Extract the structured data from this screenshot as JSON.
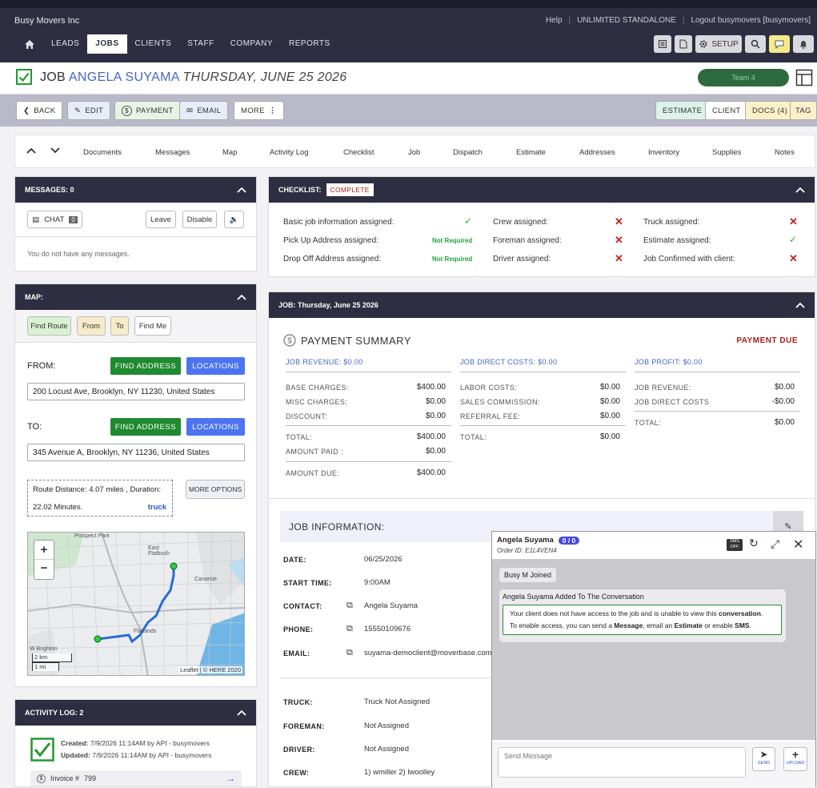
{
  "header": {
    "company": "Busy Movers Inc",
    "links": [
      "Help",
      "UNLIMITED STANDALONE",
      "Logout busymovers [busymovers]"
    ],
    "nav": [
      "LEADS",
      "JOBS",
      "CLIENTS",
      "STAFF",
      "COMPANY",
      "REPORTS"
    ],
    "active_nav": "JOBS",
    "setup_label": "SETUP"
  },
  "job": {
    "prefix": "JOB",
    "client_name": "ANGELA SUYAMA",
    "date": "THURSDAY, JUNE 25 2026",
    "team": "Team 4"
  },
  "actions": {
    "back": "BACK",
    "edit": "EDIT",
    "payment": "PAYMENT",
    "email": "EMAIL",
    "more": "MORE",
    "estimate": "ESTIMATE",
    "client": "CLIENT",
    "docs": "DOCS (4)",
    "tag": "TAG"
  },
  "tabs": [
    "Documents",
    "Messages",
    "Map",
    "Activity Log",
    "Checklist",
    "Job",
    "Dispatch",
    "Estimate",
    "Addresses",
    "Inventory",
    "Supplies",
    "Notes"
  ],
  "messages": {
    "title": "MESSAGES:",
    "count": "0",
    "chat_label": "CHAT",
    "chat_count": "0",
    "leave": "Leave",
    "disable": "Disable",
    "empty": "You do not have any messages."
  },
  "map": {
    "title": "MAP:",
    "find_route": "Find Route",
    "from_btn": "From",
    "to_btn": "To",
    "find_me": "Find Me",
    "from_label": "FROM:",
    "to_label": "TO:",
    "find_address": "FIND ADDRESS",
    "locations": "LOCATIONS",
    "from_value": "200 Locust Ave, Brooklyn, NY 11230, United States",
    "to_value": "345 Avenue A, Brooklyn, NY 11236, United States",
    "route_line1": "Route Distance: 4.07 miles , Duration:",
    "route_line2": "22.02 Minutes.",
    "route_mode": "truck",
    "more_options": "MORE OPTIONS",
    "zoom_in": "+",
    "zoom_out": "−",
    "scale_km": "2 km",
    "scale_mi": "1 mi",
    "attribution": "Leaflet | © HERE 2020",
    "labels": [
      "Prospect Park",
      "East Flatbush",
      "Canarsie",
      "Flatlands",
      "W Brighton"
    ]
  },
  "activity": {
    "title": "ACTIVITY LOG:",
    "count": "2",
    "created": "Created:",
    "created_val": "7/9/2026 11:14AM by API - busymovers",
    "updated": "Updated:",
    "updated_val": "7/9/2026 11:14AM by API - busymovers",
    "invoice_label": "Invoice #",
    "invoice_num": "799"
  },
  "checklist": {
    "title": "CHECKLIST:",
    "status": "COMPLETE",
    "items": [
      {
        "label": "Basic job information assigned:",
        "state": "ok"
      },
      {
        "label": "Pick Up Address assigned:",
        "state": "Not Required"
      },
      {
        "label": "Drop Off Address assigned:",
        "state": "Not Required"
      },
      {
        "label": "Crew assigned:",
        "state": "no"
      },
      {
        "label": "Foreman assigned:",
        "state": "no"
      },
      {
        "label": "Driver assigned:",
        "state": "no"
      },
      {
        "label": "Truck assigned:",
        "state": "no"
      },
      {
        "label": "Estimate assigned:",
        "state": "ok"
      },
      {
        "label": "Job Confirmed with client:",
        "state": "no"
      }
    ]
  },
  "jobpanel": {
    "title": "JOB:",
    "title_date": "Thursday, June 25 2026",
    "payment_title": "PAYMENT SUMMARY",
    "payment_status": "PAYMENT DUE",
    "revenue_head": "JOB REVENUE: $0.00",
    "costs_head": "JOB DIRECT COSTS: $0.00",
    "profit_head": "JOB PROFIT: $0.00",
    "revenue_rows": [
      [
        "BASE CHARGES:",
        "$400.00"
      ],
      [
        "MISC CHARGES:",
        "$0.00"
      ],
      [
        "DISCOUNT:",
        "$0.00"
      ]
    ],
    "revenue_total": [
      "TOTAL:",
      "$400.00"
    ],
    "amount_paid": [
      "AMOUNT PAID :",
      "$0.00"
    ],
    "amount_due": [
      "AMOUNT DUE:",
      "$400.00"
    ],
    "cost_rows": [
      [
        "LABOR COSTS:",
        "$0.00"
      ],
      [
        "SALES COMMISSION:",
        "$0.00"
      ],
      [
        "REFERRAL FEE:",
        "$0.00"
      ]
    ],
    "cost_total": [
      "TOTAL:",
      "$0.00"
    ],
    "profit_rows": [
      [
        "JOB REVENUE:",
        "$0.00"
      ],
      [
        "JOB DIRECT COSTS",
        "-$0.00"
      ]
    ],
    "profit_total": [
      "TOTAL:",
      "$0.00"
    ],
    "info_title": "JOB INFORMATION:",
    "info": [
      {
        "label": "DATE:",
        "value": "06/25/2026"
      },
      {
        "label": "START TIME:",
        "value": "9:00AM"
      },
      {
        "label": "CONTACT:",
        "value": "Angela Suyama"
      },
      {
        "label": "PHONE:",
        "value": "15550109676"
      },
      {
        "label": "EMAIL:",
        "value": "suyama-democlient@moverbase.com"
      }
    ],
    "assign": [
      {
        "label": "TRUCK:",
        "value": "Truck Not Assigned"
      },
      {
        "label": "FOREMAN:",
        "value": "Not Assigned"
      },
      {
        "label": "DRIVER:",
        "value": "Not Assigned"
      },
      {
        "label": "CREW:",
        "value": "1) wmiller  2) lwoolley"
      }
    ]
  },
  "chat": {
    "name": "Angela Suyama",
    "badge": "0 / 0",
    "order": "Order ID: E1L4VEN4",
    "sms_off": "SMS OFF",
    "joined": "Busy M Joined",
    "added": "Angela Suyama Added To The Conversation",
    "notice_1": "Your client does not have access to the job and is unable to view this ",
    "notice_b1": "conversation",
    "notice_2": "To enable access, you can send a ",
    "notice_b2": "Message",
    "notice_3": ", email an ",
    "notice_b3": "Estimate",
    "notice_4": " or enable ",
    "notice_b4": "SMS",
    "placeholder": "Send Message",
    "send": "SEND",
    "upload": "UPLOAD"
  }
}
